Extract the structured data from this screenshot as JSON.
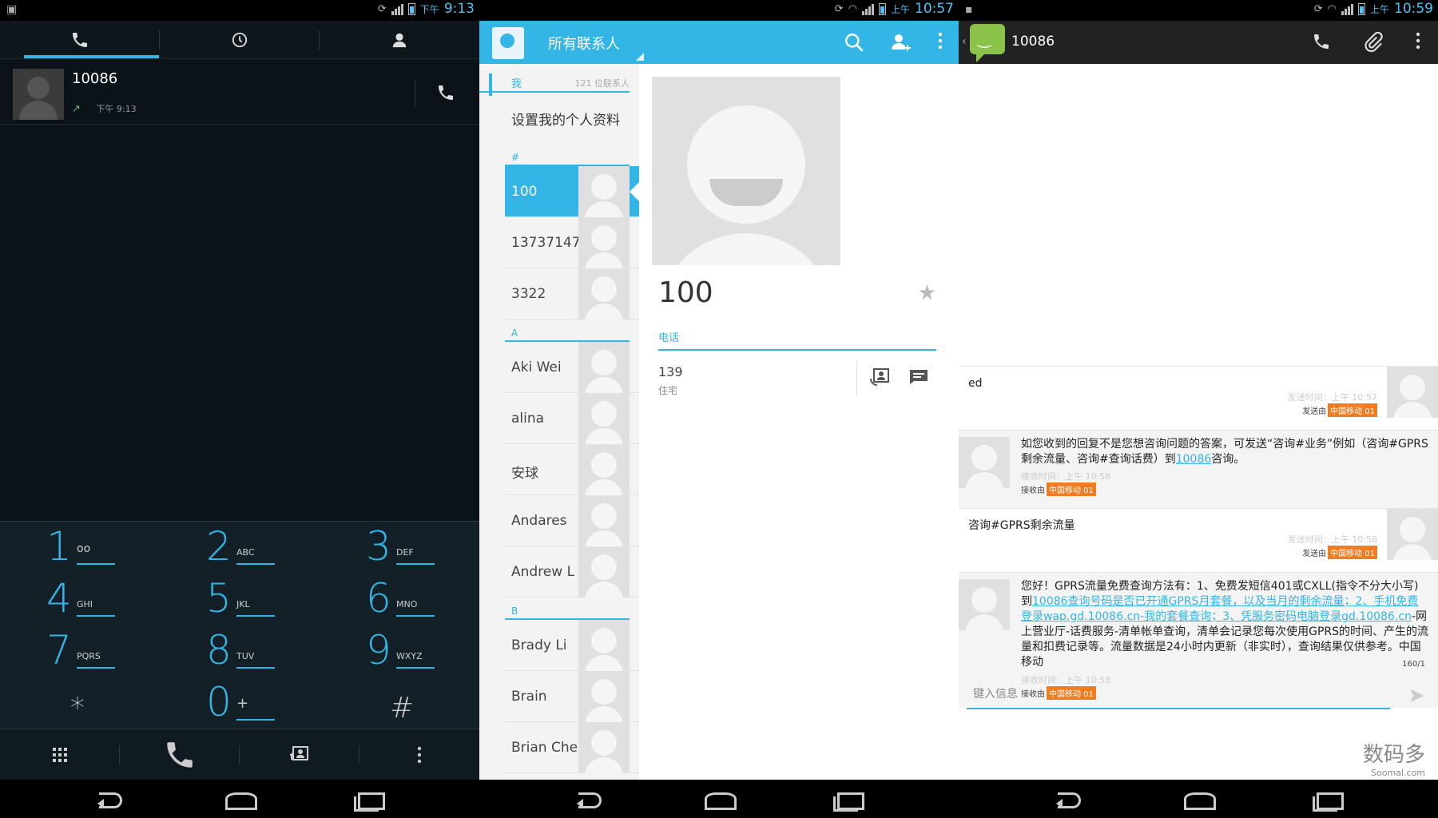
{
  "screen1": {
    "status": {
      "ampm": "下午",
      "time": "9:13"
    },
    "tabs": [
      {
        "icon": "phone-icon",
        "active": true
      },
      {
        "icon": "clock-icon",
        "active": false
      },
      {
        "icon": "person-icon",
        "active": false
      }
    ],
    "recent": {
      "name": "10086",
      "time": "下午 9:13"
    },
    "keys": [
      {
        "num": "1",
        "letters": ""
      },
      {
        "num": "2",
        "letters": "ABC"
      },
      {
        "num": "3",
        "letters": "DEF"
      },
      {
        "num": "4",
        "letters": "GHI"
      },
      {
        "num": "5",
        "letters": "JKL"
      },
      {
        "num": "6",
        "letters": "MNO"
      },
      {
        "num": "7",
        "letters": "PQRS"
      },
      {
        "num": "8",
        "letters": "TUV"
      },
      {
        "num": "9",
        "letters": "WXYZ"
      },
      {
        "num": "*",
        "letters": ""
      },
      {
        "num": "0",
        "letters": "+"
      },
      {
        "num": "#",
        "letters": ""
      }
    ]
  },
  "screen2": {
    "status": {
      "ampm": "上午",
      "time": "10:57"
    },
    "title": "所有联系人",
    "me_header": "我",
    "count": "121 位联系人",
    "set_profile": "设置我的个人资料",
    "sections": {
      "hash": "#",
      "a": "A",
      "b": "B"
    },
    "contacts_hash": [
      "100",
      "13737147",
      "3322"
    ],
    "contacts_a": [
      "Aki Wei",
      "alina",
      "安球",
      "Andares",
      "Andrew L"
    ],
    "contacts_b": [
      "Brady Li",
      "Brain",
      "Brian Che"
    ],
    "detail": {
      "name": "100",
      "phone_label": "电话",
      "phone": "139",
      "phone_type": "住宅"
    }
  },
  "screen3": {
    "status": {
      "ampm": "上午",
      "time": "10:59"
    },
    "title": "10086",
    "messages": [
      {
        "dir": "out",
        "text": "ed",
        "time": "发送时间：上午 10:57",
        "via": "发送由",
        "op": "中国移动 01"
      },
      {
        "dir": "in",
        "text_pre": "如您收到的回复不是您想咨询问题的答案，可发送“咨询#业务”例如（咨询#GPRS剩余流量、咨询#查询话费）到",
        "link": "10086",
        "text_post": "咨询。",
        "time": "接收时间：上午 10:58",
        "via": "接收由",
        "op": "中国移动 01"
      },
      {
        "dir": "out",
        "text": "咨询#GPRS剩余流量",
        "time": "发送时间：上午 10:58",
        "via": "发送由",
        "op": "中国移动 01"
      },
      {
        "dir": "in",
        "text_pre": "您好！GPRS流量免费查询方法有：1、免费发短信401或CXLL(指令不分大小写)到",
        "link": "10086查询号码是否已开通GPRS月套餐，以及当月的剩余流量；2、手机免费登录wap.gd.10086.cn-我的套餐查询；3、凭服务密码电脑登录gd.10086.cn",
        "text_post": "-网上营业厅-话费服务-清单帐单查询，清单会记录您每次使用GPRS的时间、产生的流量和扣费记录等。流量数据是24小时内更新（非实时），查询结果仅供参考。中国移动",
        "time": "接收时间：上午 10:58",
        "via": "接收由",
        "op": "中国移动 01"
      }
    ],
    "counter": "160/1",
    "input_placeholder": "键入信息",
    "watermark": "数码多",
    "watermark_sub": "Soomal.com"
  },
  "colors": {
    "accent": "#33b5e5",
    "operator": "#f07c22",
    "sms_green": "#8bc34a"
  }
}
